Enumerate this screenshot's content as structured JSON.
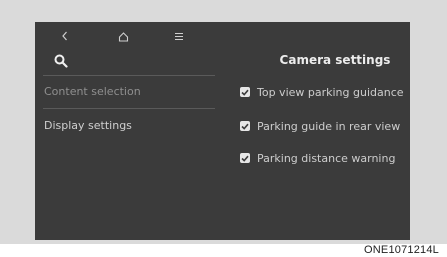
{
  "nav": {
    "back_icon": "chevron-left-icon",
    "home_icon": "home-icon",
    "menu_icon": "menu-icon"
  },
  "search_icon": "search-icon",
  "sidebar": {
    "items": [
      {
        "label": "Content selection"
      },
      {
        "label": "Display settings"
      }
    ]
  },
  "main": {
    "title": "Camera settings",
    "options": [
      {
        "label": "Top view parking guidance",
        "checked": true
      },
      {
        "label": "Parking guide in rear view",
        "checked": true
      },
      {
        "label": "Parking distance warning",
        "checked": true
      }
    ]
  },
  "caption": "ONE1071214L",
  "colors": {
    "screen": "#3b3b3b",
    "frame": "#dadada",
    "text": "#cdcdcd",
    "checkbox": "#e6e6e6"
  }
}
